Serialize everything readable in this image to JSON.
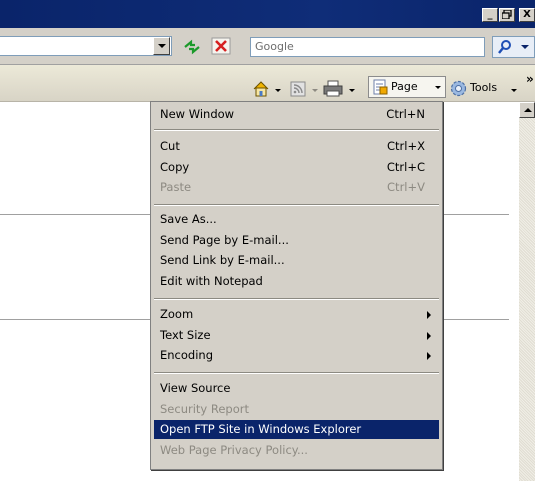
{
  "window": {
    "buttons": {
      "minimize": "_",
      "maximize": "□",
      "close": "X"
    }
  },
  "search": {
    "placeholder": "Google"
  },
  "commandbar": {
    "page_label": "Page",
    "tools_label": "Tools",
    "chevron": "»"
  },
  "menu": {
    "items": [
      {
        "label": "New Window",
        "shortcut": "Ctrl+N"
      },
      {
        "label": "Cut",
        "shortcut": "Ctrl+X"
      },
      {
        "label": "Copy",
        "shortcut": "Ctrl+C"
      },
      {
        "label": "Paste",
        "shortcut": "Ctrl+V",
        "disabled": true
      },
      {
        "label": "Save As..."
      },
      {
        "label": "Send Page by E-mail..."
      },
      {
        "label": "Send Link by E-mail..."
      },
      {
        "label": "Edit with Notepad"
      },
      {
        "label": "Zoom",
        "submenu": true
      },
      {
        "label": "Text Size",
        "submenu": true
      },
      {
        "label": "Encoding",
        "submenu": true
      },
      {
        "label": "View Source"
      },
      {
        "label": "Security Report",
        "disabled": true
      },
      {
        "label": "Open FTP Site in Windows Explorer",
        "highlighted": true
      },
      {
        "label": "Web Page Privacy Policy...",
        "disabled": true
      }
    ]
  },
  "colors": {
    "titlebar": "#0a246a",
    "highlight": "#0a246a",
    "menu_bg": "#d4d0c8",
    "disabled_text": "#8d8a82"
  }
}
